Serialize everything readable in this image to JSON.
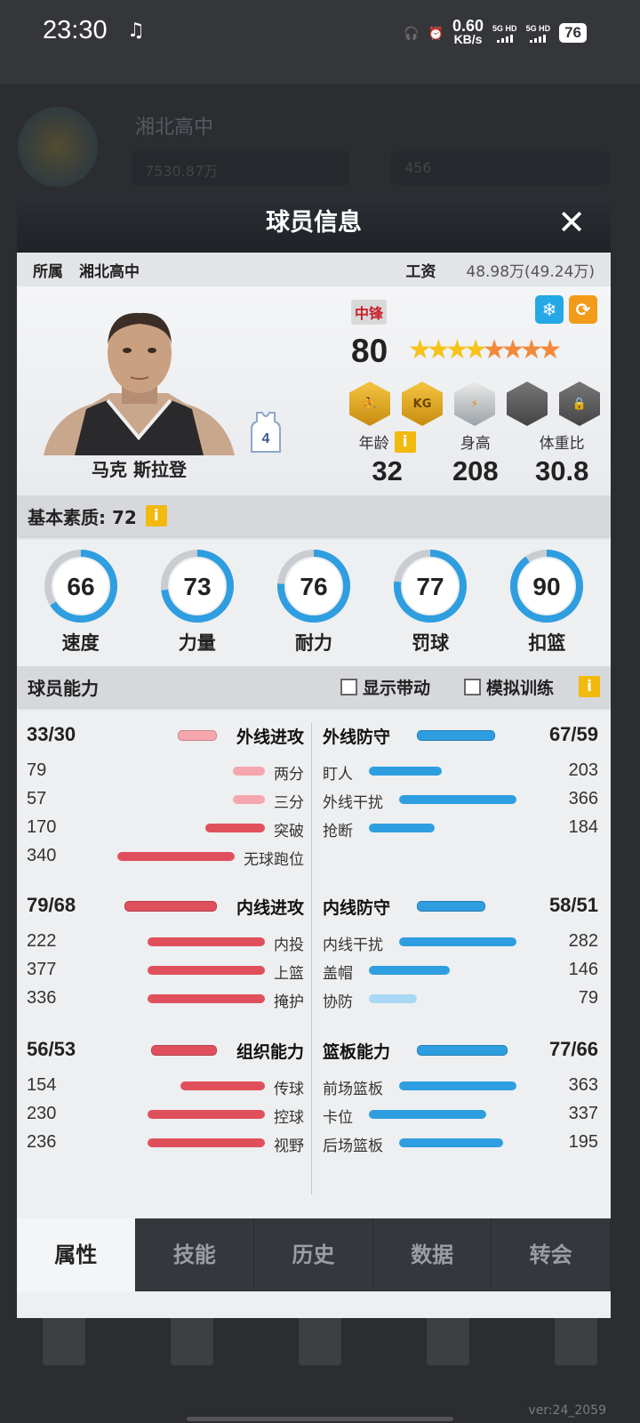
{
  "status_bar": {
    "time": "23:30",
    "net_speed": "0.60",
    "net_unit": "KB/s",
    "sig1": "5G HD",
    "sig2": "5G HD",
    "battery": "76"
  },
  "background": {
    "school": "湘北高中",
    "coins": "7530.87万",
    "gems": "456",
    "version": "ver:24_2059"
  },
  "modal": {
    "title": "球员信息",
    "affiliation_label": "所属",
    "team": "湘北高中",
    "salary_label": "工资",
    "salary": "48.98万(49.24万)",
    "position": "中锋",
    "overall": "80",
    "stars_gold": 4,
    "stars_orange": 4,
    "player_name": "马克 斯拉登",
    "jersey_number": "4",
    "badge_text": "KG",
    "age_label": "年龄",
    "age": "32",
    "height_label": "身高",
    "height": "208",
    "weight_label": "体重比",
    "weight": "30.8",
    "basic_label": "基本素质: 72",
    "gauges": [
      {
        "label": "速度",
        "value": "66"
      },
      {
        "label": "力量",
        "value": "73"
      },
      {
        "label": "耐力",
        "value": "76"
      },
      {
        "label": "罚球",
        "value": "77"
      },
      {
        "label": "扣篮",
        "value": "90"
      }
    ],
    "ability_label": "球员能力",
    "opt_show": "显示带动",
    "opt_sim": "模拟训练",
    "info_glyph": "i",
    "close_glyph": "✕"
  },
  "abilities": [
    {
      "left_value": "33/30",
      "left_label": "外线进攻",
      "right_label": "外线防守",
      "right_value": "67/59",
      "left_ratio": 0.33,
      "right_ratio": 0.67,
      "header": true
    },
    {
      "left_value": "79",
      "left_label": "两分",
      "right_label": "盯人",
      "right_value": "203",
      "left_ratio": 0.24,
      "right_ratio": 0.62
    },
    {
      "left_value": "57",
      "left_label": "三分",
      "right_label": "外线干扰",
      "right_value": "366",
      "left_ratio": 0.17,
      "right_ratio": 1.0
    },
    {
      "left_value": "170",
      "left_label": "突破",
      "right_label": "抢断",
      "right_value": "184",
      "left_ratio": 0.51,
      "right_ratio": 0.56
    },
    {
      "left_value": "340",
      "left_label": "无球跑位",
      "right_label": "",
      "right_value": "",
      "left_ratio": 1.0,
      "right_ratio": 0
    },
    {
      "left_value": "79/68",
      "left_label": "内线进攻",
      "right_label": "内线防守",
      "right_value": "58/51",
      "left_ratio": 0.79,
      "right_ratio": 0.58,
      "header": true
    },
    {
      "left_value": "222",
      "left_label": "内投",
      "right_label": "内线干扰",
      "right_value": "282",
      "left_ratio": 1.0,
      "right_ratio": 1.0
    },
    {
      "left_value": "377",
      "left_label": "上篮",
      "right_label": "盖帽",
      "right_value": "146",
      "left_ratio": 1.0,
      "right_ratio": 0.69
    },
    {
      "left_value": "336",
      "left_label": "掩护",
      "right_label": "协防",
      "right_value": "79",
      "left_ratio": 1.0,
      "right_ratio": 0.41
    },
    {
      "left_value": "56/53",
      "left_label": "组织能力",
      "right_label": "篮板能力",
      "right_value": "77/66",
      "left_ratio": 0.56,
      "right_ratio": 0.77,
      "header": true
    },
    {
      "left_value": "154",
      "left_label": "传球",
      "right_label": "前场篮板",
      "right_value": "363",
      "left_ratio": 0.72,
      "right_ratio": 1.0
    },
    {
      "left_value": "230",
      "left_label": "控球",
      "right_label": "卡位",
      "right_value": "337",
      "left_ratio": 1.0,
      "right_ratio": 1.0
    },
    {
      "left_value": "236",
      "left_label": "视野",
      "right_label": "后场篮板",
      "right_value": "195",
      "left_ratio": 1.0,
      "right_ratio": 0.89
    }
  ],
  "tabs": [
    {
      "label": "属性",
      "active": true
    },
    {
      "label": "技能"
    },
    {
      "label": "历史"
    },
    {
      "label": "数据"
    },
    {
      "label": "转会"
    }
  ],
  "colors": {
    "attack": "#e0505c",
    "attack_light": "#f5a7ad",
    "defense": "#2e9ee0",
    "defense_light": "#a8d8f4",
    "gauge_ring": "#2e9ee0"
  }
}
